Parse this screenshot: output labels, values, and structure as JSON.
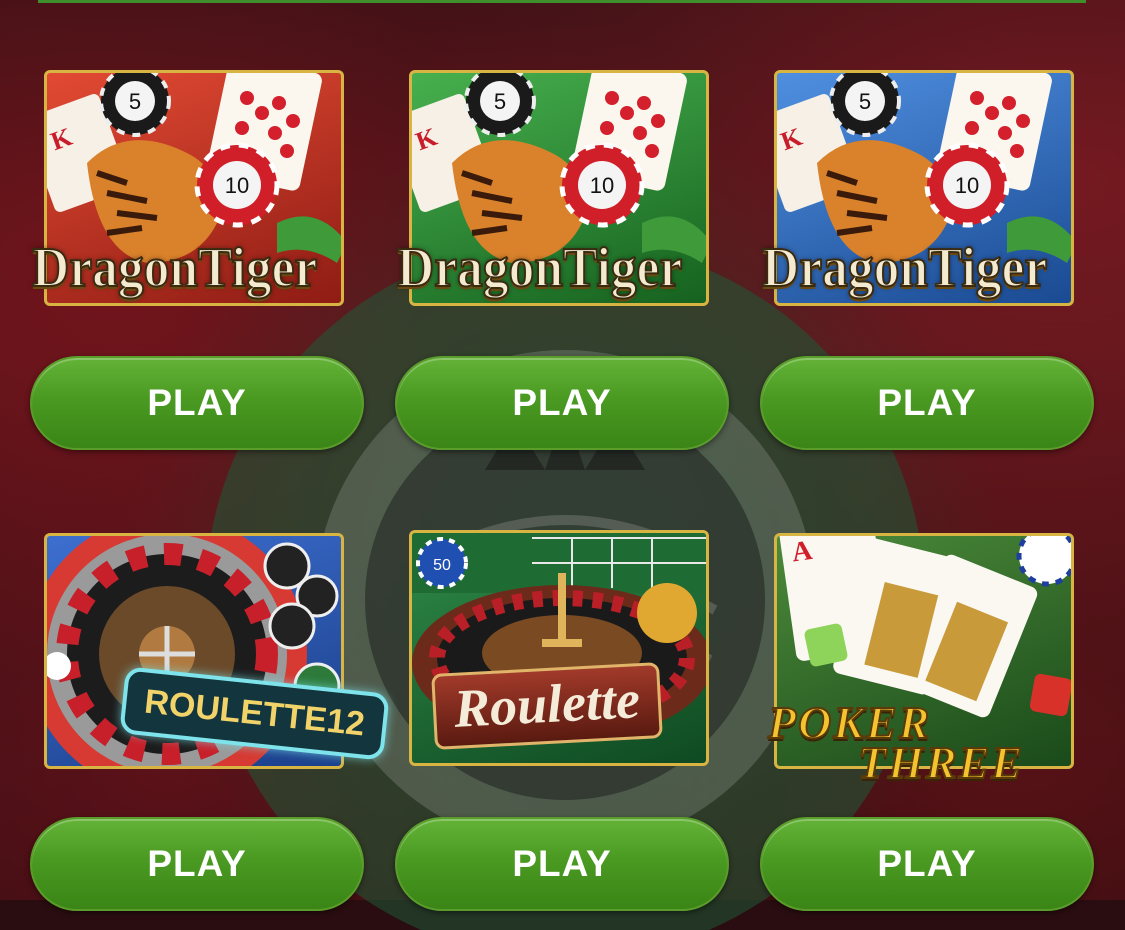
{
  "games": [
    {
      "title": "DragonTiger",
      "play_label": "PLAY",
      "accent": "#c93a2b"
    },
    {
      "title": "DragonTiger",
      "play_label": "PLAY",
      "accent": "#2f8f3a"
    },
    {
      "title": "DragonTiger",
      "play_label": "PLAY",
      "accent": "#2e6fb5"
    },
    {
      "title": "ROULETTE12",
      "play_label": "PLAY",
      "accent": "#2e5fb5"
    },
    {
      "title": "Roulette",
      "play_label": "PLAY",
      "accent": "#1f6b34"
    },
    {
      "title_line1": "POKER",
      "title_line2": "THREE",
      "play_label": "PLAY",
      "accent": "#3a6b2a"
    }
  ],
  "chip_values": {
    "top": "5",
    "bottom": "10",
    "roulette_chip": "50"
  },
  "colors": {
    "play_button": "#4a9a22",
    "frame_gold": "#d8b443",
    "background": "#3a1216"
  }
}
